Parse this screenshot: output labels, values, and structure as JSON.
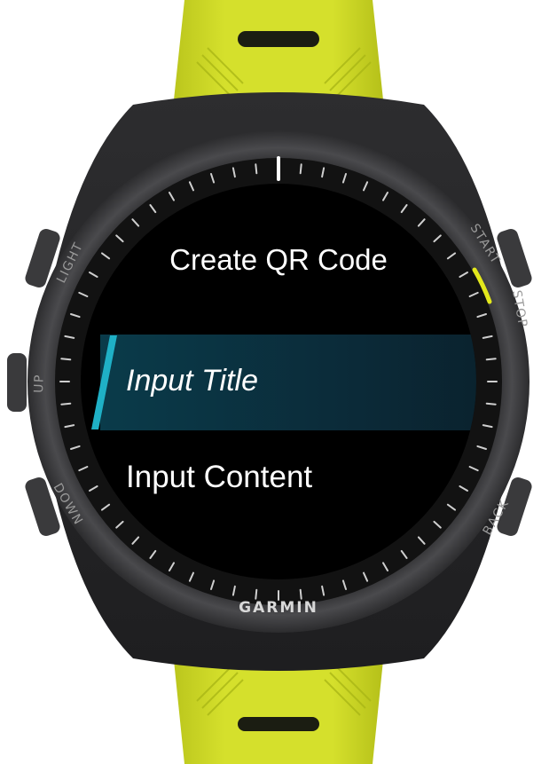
{
  "device": {
    "brand": "GARMIN",
    "buttons": {
      "light": "LIGHT",
      "up": "UP",
      "down": "DOWN",
      "start": "START",
      "stop": "STOP",
      "back": "BACK"
    },
    "band_color": "#d4e02a",
    "accent_color": "#e3e81c"
  },
  "screen": {
    "title": "Create QR Code",
    "menu": [
      {
        "label": "Input Title",
        "selected": true
      },
      {
        "label": "Input Content",
        "selected": false
      }
    ]
  }
}
